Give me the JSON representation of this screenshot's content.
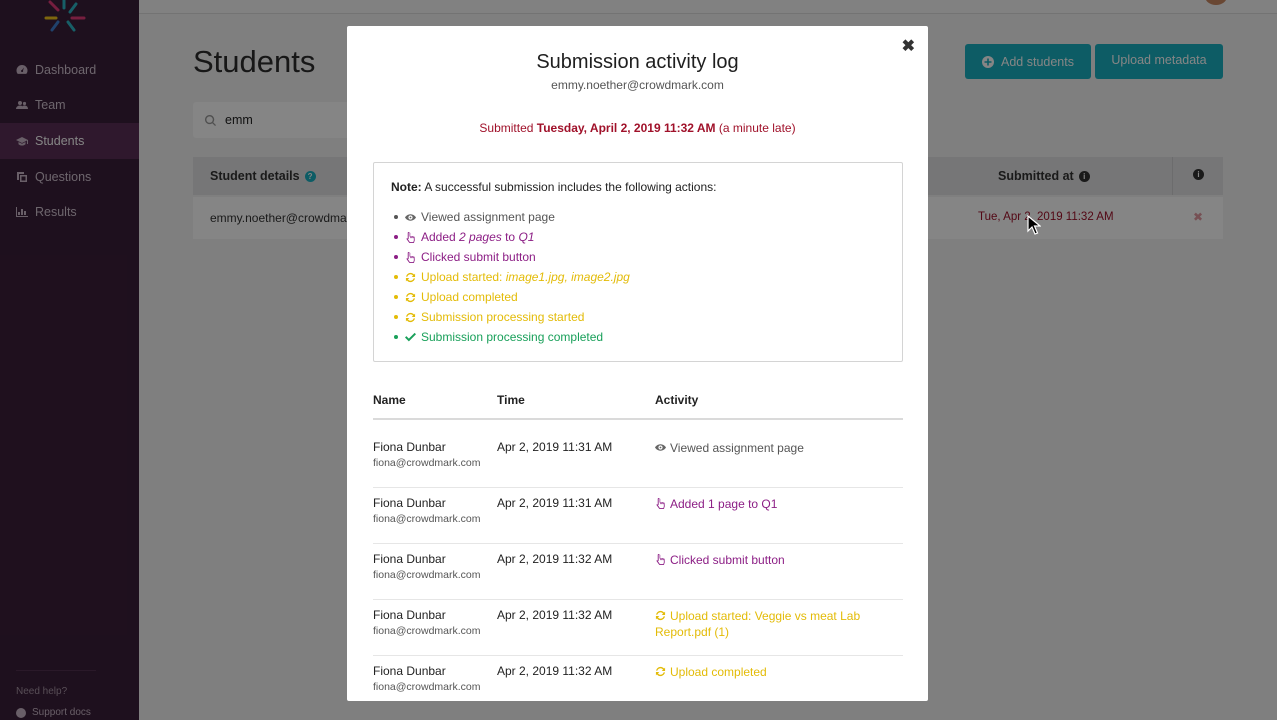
{
  "sidebar": {
    "items": [
      {
        "label": "Dashboard",
        "icon": "dashboard-icon"
      },
      {
        "label": "Team",
        "icon": "team-icon"
      },
      {
        "label": "Students",
        "icon": "graduation-cap-icon"
      },
      {
        "label": "Questions",
        "icon": "questions-icon"
      },
      {
        "label": "Results",
        "icon": "bar-chart-icon"
      }
    ],
    "help_title": "Need help?",
    "help_link": "Support docs"
  },
  "page": {
    "title": "Students",
    "search_value": "emm",
    "add_students_label": "Add students",
    "upload_metadata_label": "Upload metadata",
    "columns": {
      "student_details": "Student details",
      "submitted_at": "Submitted at"
    },
    "row": {
      "email": "emmy.noether@crowdmark",
      "submitted": "Tue, Apr 2, 2019 11:32 AM",
      "remove": "✖"
    }
  },
  "modal": {
    "title": "Submission activity log",
    "email": "emmy.noether@crowdmark.com",
    "close_label": "✖",
    "submitted_prefix": "Submitted",
    "submitted_date": "Tuesday, April 2, 2019 11:32 AM",
    "submitted_suffix": "(a minute late)",
    "note_label": "Note:",
    "note_text": "A successful submission includes the following actions:",
    "steps": [
      {
        "text": "Viewed assignment page",
        "color": "#555555",
        "icon": "eye-icon"
      },
      {
        "text": "Added",
        "em1": "2 pages",
        "mid": "to",
        "em2": "Q1",
        "color": "#8c1e85",
        "icon": "hand-pointer-icon"
      },
      {
        "text": "Clicked submit button",
        "color": "#8c1e85",
        "icon": "hand-pointer-icon"
      },
      {
        "text": "Upload started:",
        "em1": "image1.jpg, image2.jpg",
        "color": "#e3bb07",
        "icon": "refresh-icon"
      },
      {
        "text": "Upload completed",
        "color": "#e3bb07",
        "icon": "refresh-icon"
      },
      {
        "text": "Submission processing started",
        "color": "#e3bb07",
        "icon": "refresh-icon"
      },
      {
        "text": "Submission processing completed",
        "color": "#19a05a",
        "icon": "check-icon"
      }
    ],
    "log_columns": {
      "name": "Name",
      "time": "Time",
      "activity": "Activity"
    },
    "log_rows": [
      {
        "name": "Fiona Dunbar",
        "email": "fiona@crowdmark.com",
        "time": "Apr 2, 2019 11:31 AM",
        "activity": "Viewed assignment page",
        "kind": "gray"
      },
      {
        "name": "Fiona Dunbar",
        "email": "fiona@crowdmark.com",
        "time": "Apr 2, 2019 11:31 AM",
        "activity": "Added 1 page to Q1",
        "kind": "purple"
      },
      {
        "name": "Fiona Dunbar",
        "email": "fiona@crowdmark.com",
        "time": "Apr 2, 2019 11:32 AM",
        "activity": "Clicked submit button",
        "kind": "purple"
      },
      {
        "name": "Fiona Dunbar",
        "email": "fiona@crowdmark.com",
        "time": "Apr 2, 2019 11:32 AM",
        "activity": "Upload started: Veggie vs meat Lab Report.pdf (1)",
        "kind": "yellow"
      },
      {
        "name": "Fiona Dunbar",
        "email": "fiona@crowdmark.com",
        "time": "Apr 2, 2019 11:32 AM",
        "activity": "Upload completed",
        "kind": "yellow"
      }
    ]
  },
  "colors": {
    "sidebar": "#3b1f3a",
    "accent": "#1ab1c1",
    "late": "#a0112a",
    "purple": "#8c1e85",
    "yellow": "#e3bb07",
    "green": "#19a05a"
  }
}
